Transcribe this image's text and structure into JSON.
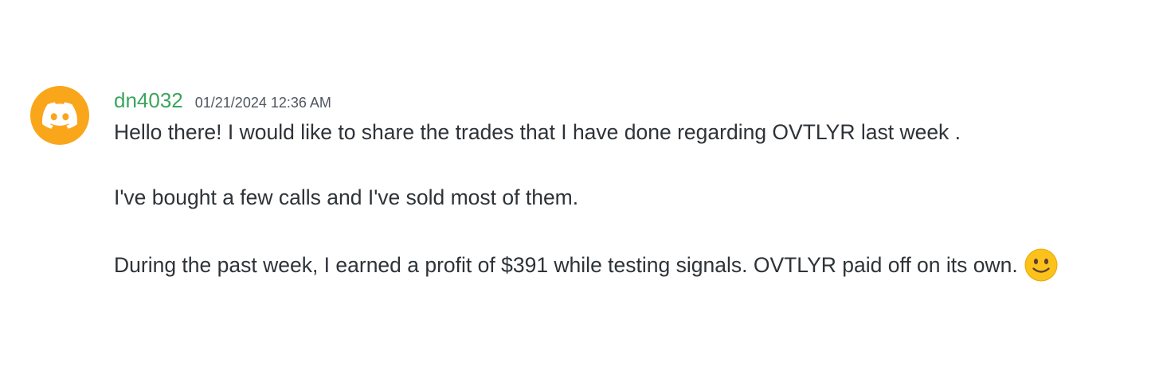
{
  "message": {
    "author": "dn4032",
    "author_color": "#3ba55d",
    "avatar_color": "#faa61a",
    "avatar_icon": "discord-logo-icon",
    "timestamp": "01/21/2024 12:36 AM",
    "lines": [
      "Hello there! I would like to share the trades that I have done regarding OVTLYR last week .",
      "I've bought a few calls and I've sold most of them.",
      "During the past week, I earned a profit of $391 while testing signals. OVTLYR paid off on its own."
    ],
    "emoji": "slightly-smiling-face-icon"
  }
}
